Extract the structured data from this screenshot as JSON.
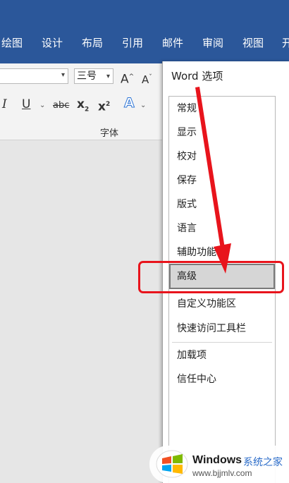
{
  "ribbon_tabs": [
    "绘图",
    "设计",
    "布局",
    "引用",
    "邮件",
    "审阅",
    "视图",
    "开"
  ],
  "font": {
    "name_value": "",
    "size_value": "三号",
    "grow_icon_label": "A",
    "shrink_icon_label": "A",
    "italic": "I",
    "underline": "U",
    "strike": "abc",
    "subscript": "x",
    "subscript_mark": "2",
    "superscript": "x",
    "superscript_mark": "2",
    "effects": "A",
    "group_label": "字体"
  },
  "dialog": {
    "title": "Word 选项",
    "categories": [
      "常规",
      "显示",
      "校对",
      "保存",
      "版式",
      "语言",
      "辅助功能",
      "高级",
      "自定义功能区",
      "快速访问工具栏",
      "加载项",
      "信任中心"
    ],
    "selected": "高级"
  },
  "colors": {
    "tab_bar": "#2b579a",
    "annotation": "#e8141c"
  },
  "watermark": {
    "brand": "Windows",
    "brand_cn": "系统之家",
    "url": "www.bjjmlv.com"
  }
}
